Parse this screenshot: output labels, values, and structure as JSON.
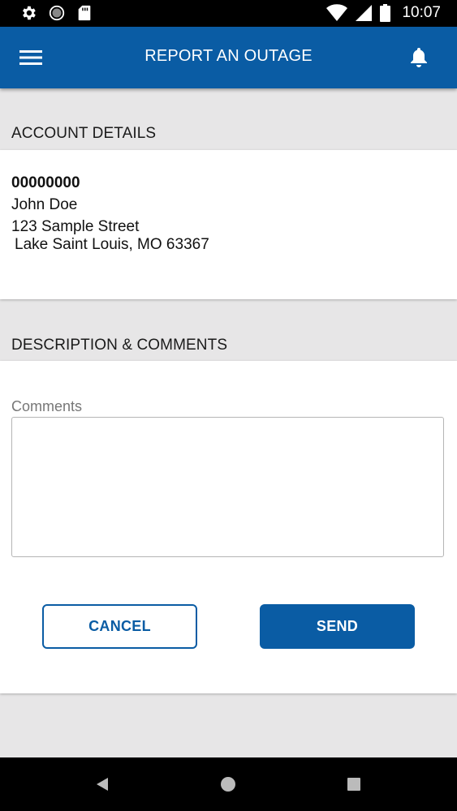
{
  "status_bar": {
    "time": "10:07",
    "left_icons": [
      "gear-icon",
      "sync-circle-icon",
      "sd-card-icon"
    ],
    "right_icons": [
      "wifi-icon",
      "signal-icon",
      "battery-icon"
    ]
  },
  "app_bar": {
    "title": "REPORT AN OUTAGE",
    "menu_icon": "hamburger-menu-icon",
    "bell_icon": "bell-icon"
  },
  "account_section": {
    "header": "ACCOUNT DETAILS",
    "account_number": "00000000",
    "name": "John Doe",
    "address_line1": "123 Sample Street",
    "address_line2": "Lake Saint Louis, MO 63367"
  },
  "comments_section": {
    "header": "DESCRIPTION & COMMENTS",
    "comments_label": "Comments",
    "comments_value": ""
  },
  "actions": {
    "cancel_label": "CANCEL",
    "send_label": "SEND"
  },
  "nav_bar": {
    "icons": [
      "back-triangle-icon",
      "home-circle-icon",
      "recents-square-icon"
    ]
  },
  "colors": {
    "brand_blue": "#0a5ca4",
    "background": "#e7e6e7",
    "status_bar": "#000000"
  }
}
